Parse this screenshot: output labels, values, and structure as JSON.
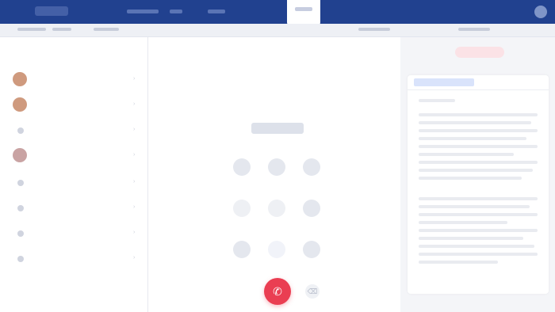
{
  "colors": {
    "topbar": "#21418f",
    "call_button": "#ea3e52",
    "accent_blue": "#5779d4",
    "panel_bg": "#ffffff"
  },
  "topbar": {
    "logo_icon": "app-logo-icon",
    "avatar_icon": "user-avatar-icon"
  },
  "sidebar": {
    "items": [
      {
        "icon": "contact-avatar-icon",
        "name": "",
        "sub": ""
      },
      {
        "icon": "contact-avatar-icon",
        "name": "",
        "sub": ""
      },
      {
        "icon": "contact-dot-icon",
        "name": "",
        "sub": ""
      },
      {
        "icon": "contact-avatar-icon",
        "name": "",
        "sub": ""
      },
      {
        "icon": "contact-dot-icon",
        "name": "",
        "sub": ""
      },
      {
        "icon": "contact-dot-icon",
        "name": "",
        "sub": ""
      },
      {
        "icon": "contact-dot-icon",
        "name": "",
        "sub": ""
      },
      {
        "icon": "contact-dot-icon",
        "name": "",
        "sub": ""
      }
    ]
  },
  "dialer": {
    "title": "",
    "keys": [
      "",
      "",
      "",
      "",
      "",
      "",
      "",
      "",
      ""
    ],
    "call_icon": "phone-icon",
    "backspace_icon": "backspace-icon"
  },
  "right_panel": {
    "action_pill": "",
    "panel_title": ""
  }
}
